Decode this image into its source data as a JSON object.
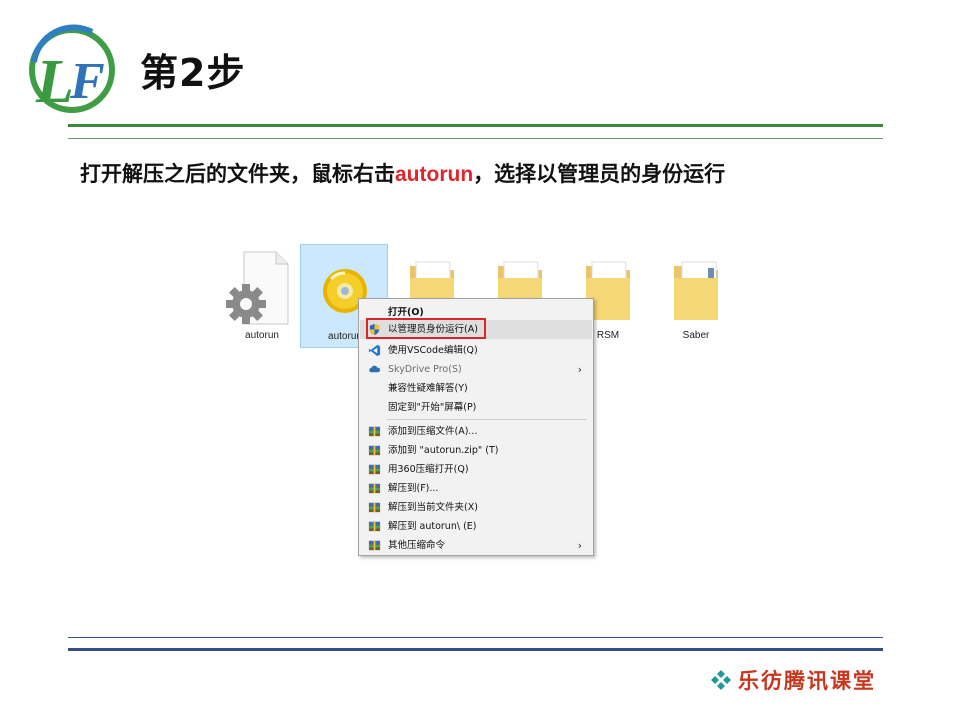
{
  "slide": {
    "step_title": "第2步",
    "instruction_before": "打开解压之后的文件夹，鼠标右击",
    "instruction_highlight": "autorun",
    "instruction_after": "，选择以管理员的身份运行",
    "brand": "乐彷腾讯课堂",
    "logo_letters": "LF"
  },
  "files": [
    {
      "label": "autorun",
      "icon": "gear-file-icon",
      "selected": false
    },
    {
      "label": "autorun",
      "icon": "disc-icon",
      "selected": true
    },
    {
      "label": "",
      "icon": "folder-icon",
      "selected": false
    },
    {
      "label": "",
      "icon": "folder-icon",
      "selected": false
    },
    {
      "label": "RSM",
      "icon": "folder-icon",
      "selected": false
    },
    {
      "label": "Saber",
      "icon": "folder-icon",
      "selected": false
    }
  ],
  "context_menu": {
    "items": [
      {
        "label": "打开(O)",
        "icon": "",
        "bold": true
      },
      {
        "label": "以管理员身份运行(A)",
        "icon": "shield-icon",
        "hover": true
      },
      {
        "label": "使用VSCode编辑(Q)",
        "icon": "vscode-icon"
      },
      {
        "label": "SkyDrive Pro(S)",
        "icon": "cloud-icon",
        "disabled": true,
        "submenu": true
      },
      {
        "label": "兼容性疑难解答(Y)",
        "icon": ""
      },
      {
        "label": "固定到\"开始\"屏幕(P)",
        "icon": ""
      },
      {
        "label": "添加到压缩文件(A)...",
        "icon": "archive-icon"
      },
      {
        "label": "添加到 \"autorun.zip\" (T)",
        "icon": "archive-icon"
      },
      {
        "label": "用360压缩打开(Q)",
        "icon": "archive-icon"
      },
      {
        "label": "解压到(F)...",
        "icon": "archive-icon"
      },
      {
        "label": "解压到当前文件夹(X)",
        "icon": "archive-icon"
      },
      {
        "label": "解压到 autorun\\ (E)",
        "icon": "archive-icon"
      },
      {
        "label": "其他压缩命令",
        "icon": "archive-icon",
        "submenu": true
      }
    ]
  },
  "colors": {
    "accent_green": "#3c8a3c",
    "accent_blue": "#34508a",
    "highlight_red": "#e0262b",
    "brand_red": "#c8361d"
  }
}
